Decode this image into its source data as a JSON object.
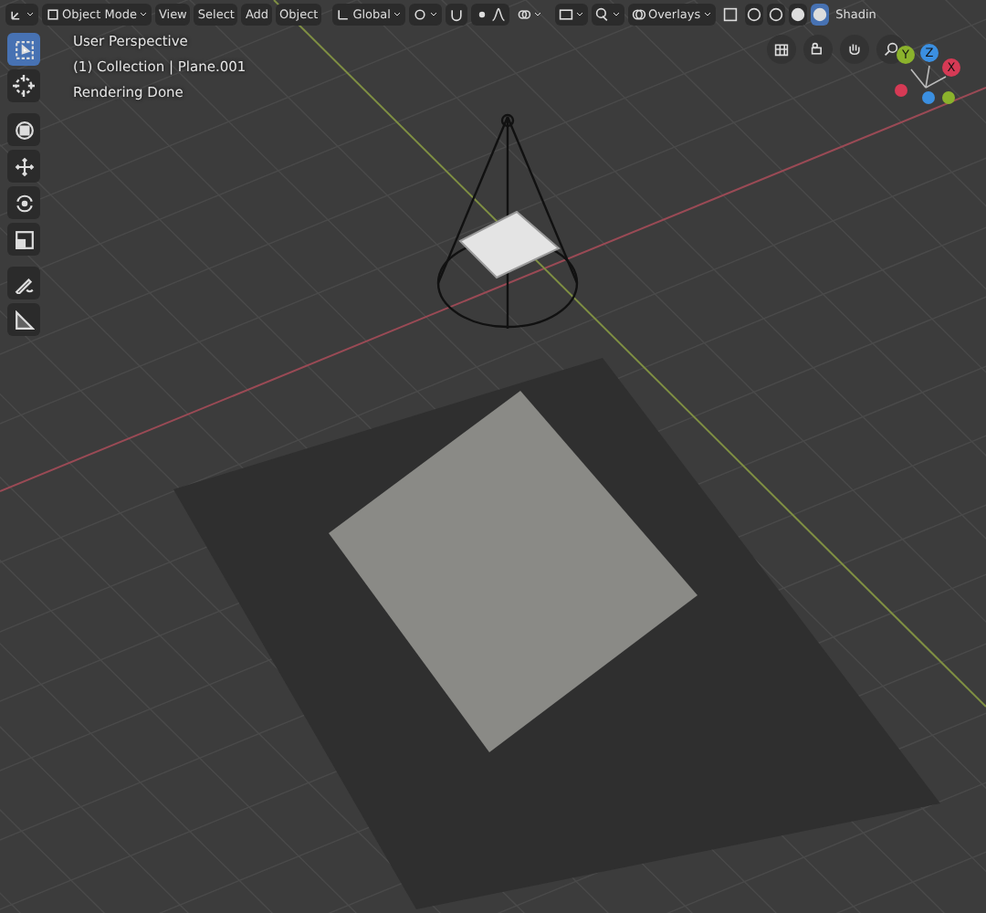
{
  "header": {
    "mode": "Object Mode",
    "menus": [
      "View",
      "Select",
      "Add",
      "Object"
    ],
    "orientation": "Global",
    "overlays": "Overlays",
    "shading_buttons": [
      {
        "selected": false
      },
      {
        "selected": false
      },
      {
        "selected": false
      },
      {
        "selected": true
      }
    ],
    "shading_label": "Shadin"
  },
  "viewport_info": [
    "User Perspective",
    "(1) Collection | Plane.001",
    "Rendering Done"
  ],
  "tools": [
    {
      "kind": "select",
      "selected": true
    },
    {
      "kind": "cursor",
      "selected": false
    },
    {
      "kind": "transform",
      "selected": false
    },
    {
      "kind": "move",
      "selected": false
    },
    {
      "kind": "rotate",
      "selected": false
    },
    {
      "kind": "scale",
      "selected": false
    },
    {
      "kind": "annotate",
      "selected": false
    },
    {
      "kind": "measure",
      "selected": false
    }
  ],
  "gizmo_axes": [
    {
      "label": "Y",
      "color": "#8bb22c"
    },
    {
      "label": "Z",
      "color": "#3b8fe0"
    },
    {
      "label": "X",
      "color": "#d63a55"
    }
  ]
}
